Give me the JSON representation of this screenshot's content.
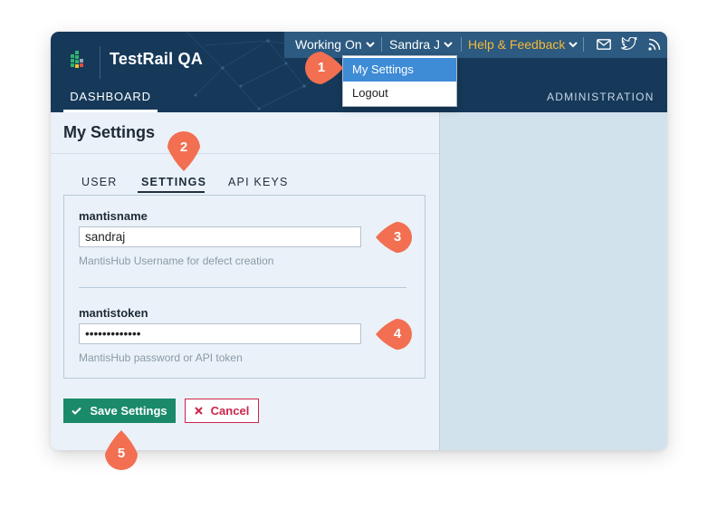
{
  "app": {
    "title": "TestRail QA"
  },
  "topbar": {
    "working_on": "Working On",
    "user": "Sandra J",
    "help": "Help & Feedback"
  },
  "nav": {
    "dashboard": "DASHBOARD",
    "administration": "ADMINISTRATION"
  },
  "dropdown": {
    "items": [
      "My Settings",
      "Logout"
    ],
    "selected": "My Settings"
  },
  "page": {
    "title": "My Settings"
  },
  "subtabs": [
    {
      "label": "USER"
    },
    {
      "label": "SETTINGS"
    },
    {
      "label": "API KEYS"
    }
  ],
  "active_subtab": "SETTINGS",
  "fields": [
    {
      "label": "mantisname",
      "value": "sandraj",
      "help": "MantisHub Username for defect creation"
    },
    {
      "label": "mantistoken",
      "value": "•••••••••••••",
      "help": "MantisHub password or API token"
    }
  ],
  "buttons": {
    "save": "Save Settings",
    "cancel": "Cancel"
  },
  "callouts": [
    "1",
    "2",
    "3",
    "4",
    "5"
  ],
  "colors": {
    "header": "#16395a",
    "topbar": "#2c5a80",
    "help_link": "#f5b93a",
    "save_button": "#1a8a6b",
    "cancel_button": "#cc2549",
    "dropdown_highlight": "#3e8bd6",
    "callout": "#f26f52"
  }
}
